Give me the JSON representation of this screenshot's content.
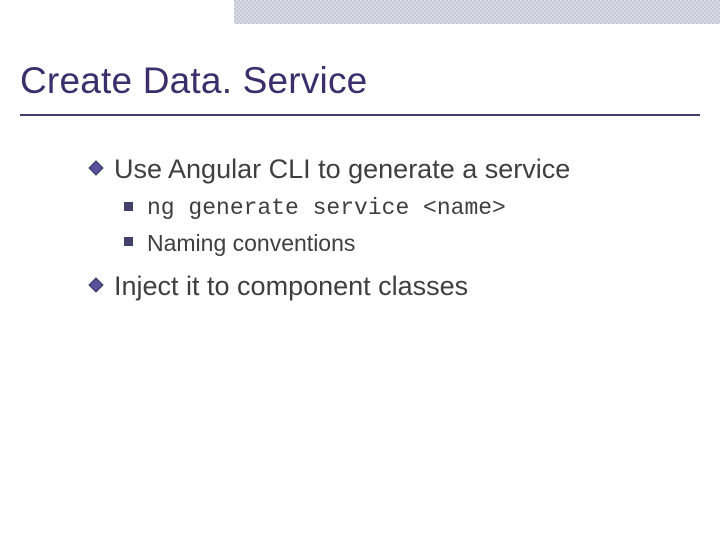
{
  "title": "Create Data. Service",
  "bullets": {
    "b1": {
      "text": "Use Angular CLI to generate a service",
      "sub": {
        "s1": "ng generate service <name>",
        "s2": "Naming conventions"
      }
    },
    "b2": {
      "text": "Inject it to component classes"
    }
  },
  "colors": {
    "title": "#3a2f6b",
    "rule": "#40406a",
    "bullet_fill": "#5a519b",
    "bullet_stroke": "#343460",
    "topbar": "#c6c8d8"
  }
}
